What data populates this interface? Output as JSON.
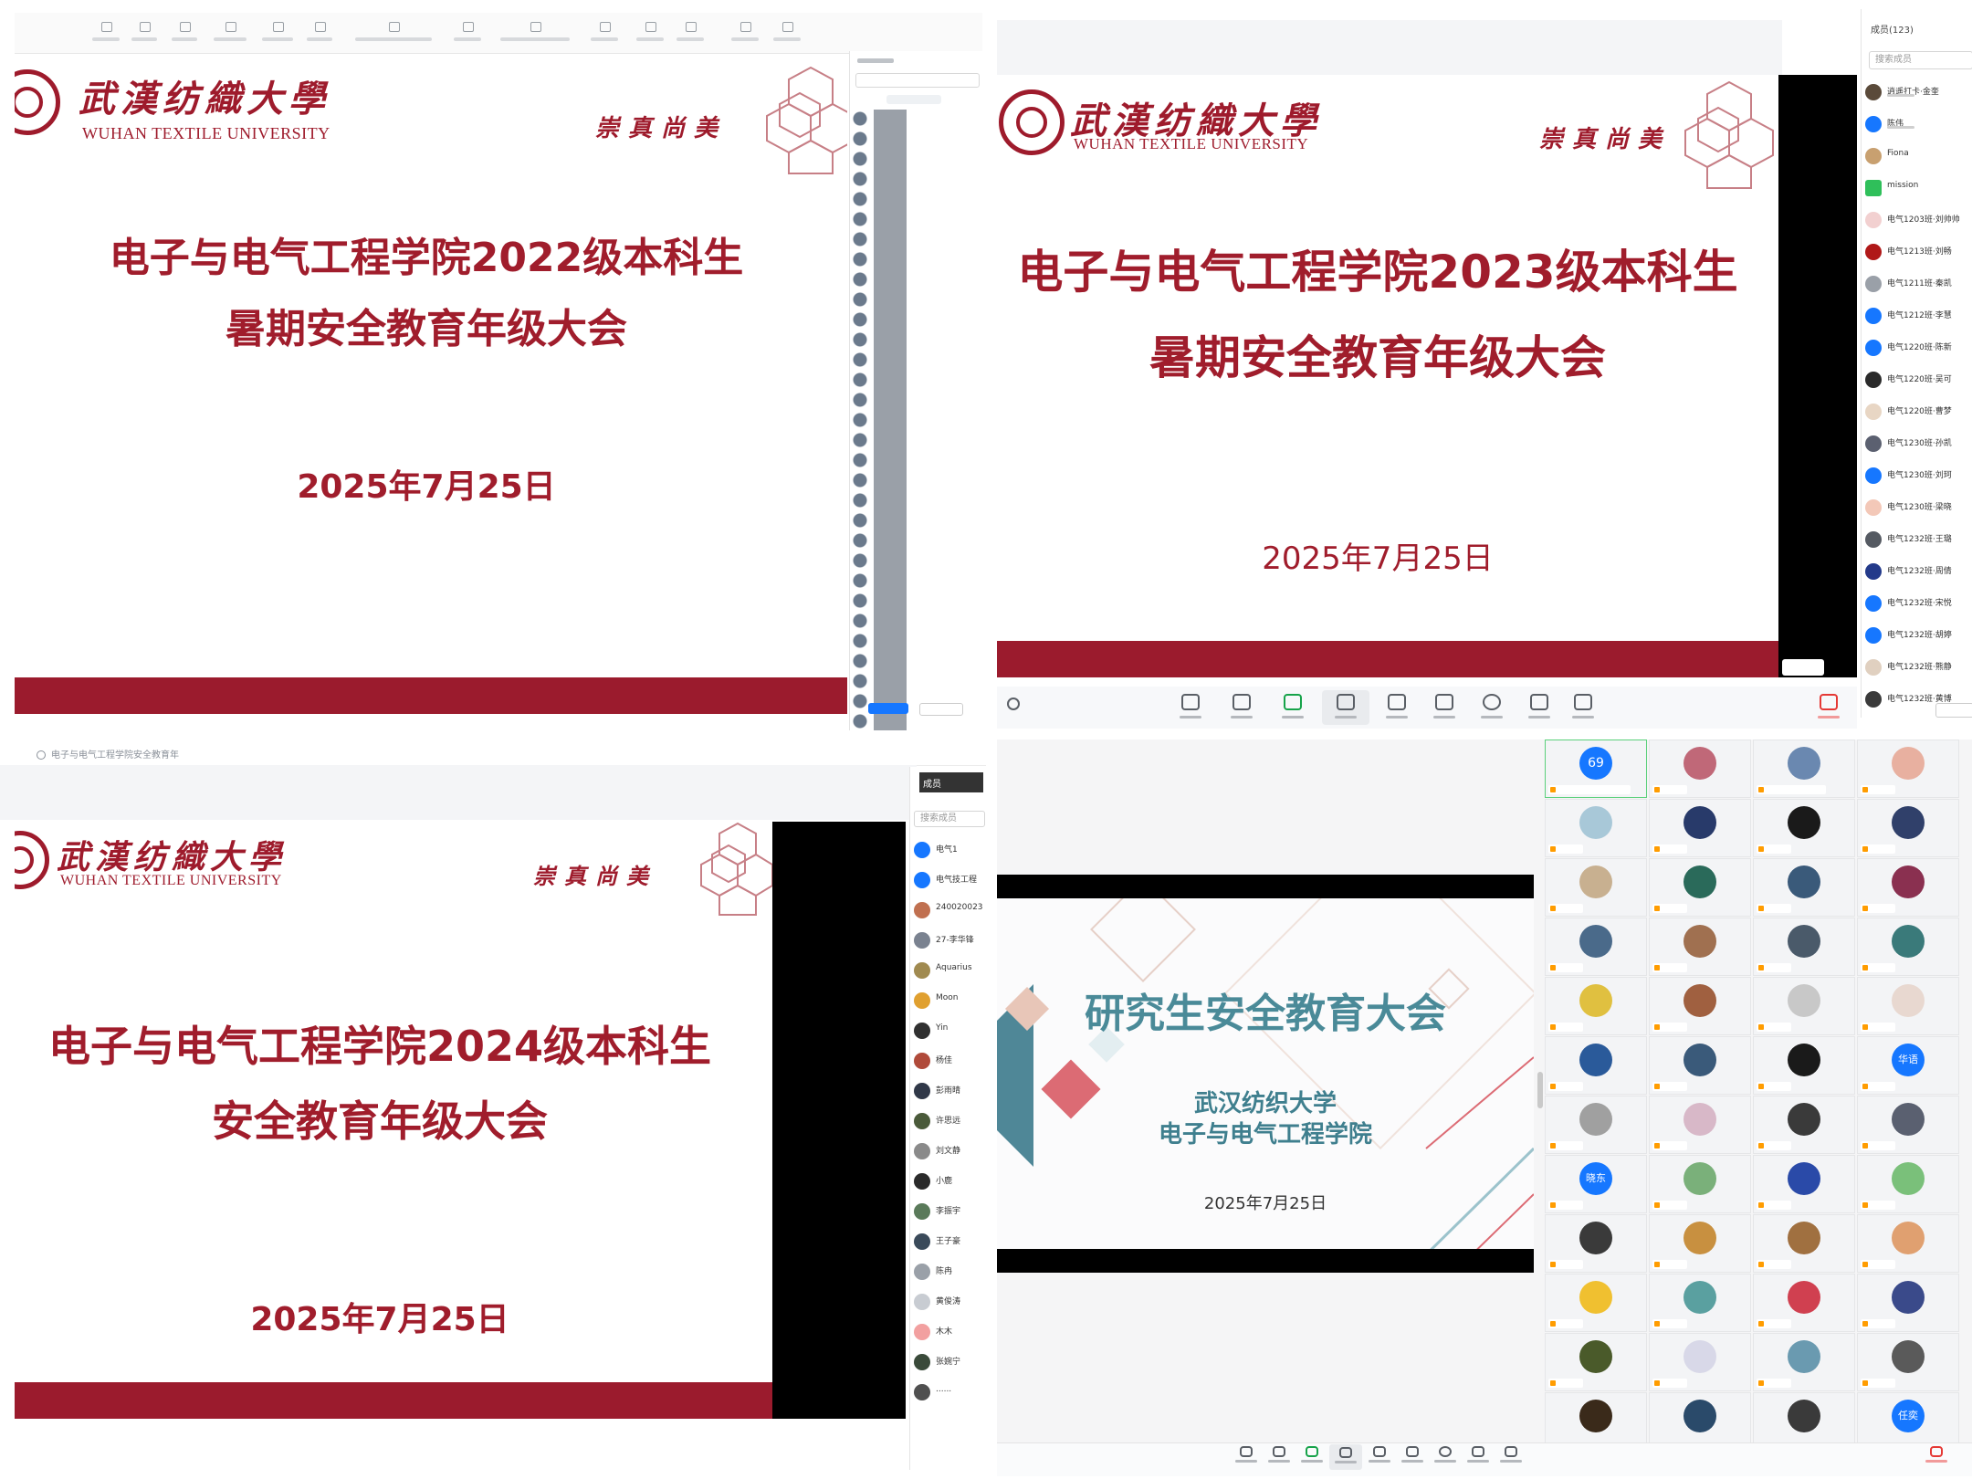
{
  "colors": {
    "brand": "#9e1b2c",
    "accent_blue": "#1677ff",
    "teal_title": "#4a8a98",
    "graphic_red": "#d95c68"
  },
  "university": {
    "name_cn": "武漢纺織大學",
    "name_en": "WUHAN TEXTILE UNIVERSITY",
    "motto": "崇真尚美"
  },
  "screens": [
    {
      "title_line1": "电子与电气工程学院2022级本科生",
      "title_line2": "暑期安全教育年级大会",
      "date": "2025年7月25日"
    },
    {
      "title_line1": "电子与电气工程学院2023级本科生",
      "title_line2": "暑期安全教育年级大会",
      "date": "2025年7月25日",
      "panel_header": "成员(123)",
      "search_placeholder": "搜索成员",
      "participants": [
        "逍遥打卡·金奎",
        "陈伟",
        "Fiona",
        "mission",
        "电气1203班·刘帅帅",
        "电气1213班·刘畅",
        "电气1211班·秦凯",
        "电气1212班·李慧",
        "电气1220班·陈新",
        "电气1220班·吴可",
        "电气1220班·曹梦",
        "电气1230班·孙凯",
        "电气1230班·刘珂",
        "电气1230班·梁晓",
        "电气1232班·王璐",
        "电气1232班·周倩",
        "电气1232班·宋悦",
        "电气1232班·胡婷",
        "电气1232班·熊静",
        "电气1232班·黄博"
      ],
      "leave_label": "离开会议",
      "controls": [
        "解除静音",
        "开启视频",
        "共享屏幕",
        "成员(123)",
        "邀请",
        "聊天",
        "录制",
        "应用",
        "设置"
      ]
    },
    {
      "title_line1": "电子与电气工程学院2024级本科生",
      "title_line2": "安全教育年级大会",
      "date": "2025年7月25日",
      "tab_title": "电子与电气工程学院安全教育年级大会",
      "panel_header": "成员",
      "search_placeholder": "搜索成员",
      "participants": [
        "电气1",
        "电气技工程",
        "240020023",
        "27-李华锋",
        "Aquarius",
        "Moon",
        "Yin",
        "杨佳",
        "彭雨晴",
        "许思远",
        "刘文静",
        "小鹿",
        "李振宇",
        "王子豪",
        "陈冉",
        "黄俊涛",
        "木木",
        "张婉宁",
        "......"
      ]
    },
    {
      "title": "研究生安全教育大会",
      "org_line1": "武汉纺织大学",
      "org_line2": "电子与电气工程学院",
      "date": "2025年7月25日",
      "first_tile_badge": "69",
      "tile_text_1": "晓东",
      "tile_text_2": "华语",
      "tile_text_3": "任奕"
    }
  ]
}
